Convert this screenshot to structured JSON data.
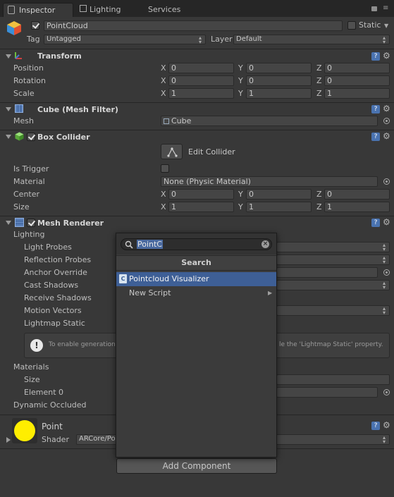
{
  "tabs": [
    {
      "label": "Inspector"
    },
    {
      "label": "Lighting"
    },
    {
      "label": "Services"
    }
  ],
  "object": {
    "name": "PointCloud",
    "active": true,
    "static_label": "Static",
    "tag_label": "Tag",
    "tag_value": "Untagged",
    "layer_label": "Layer",
    "layer_value": "Default"
  },
  "transform": {
    "title": "Transform",
    "position": {
      "label": "Position",
      "x": "0",
      "y": "0",
      "z": "0"
    },
    "rotation": {
      "label": "Rotation",
      "x": "0",
      "y": "0",
      "z": "0"
    },
    "scale": {
      "label": "Scale",
      "x": "1",
      "y": "1",
      "z": "1"
    }
  },
  "axes": {
    "x": "X",
    "y": "Y",
    "z": "Z"
  },
  "mesh_filter": {
    "title": "Cube (Mesh Filter)",
    "mesh_label": "Mesh",
    "mesh_value": "Cube"
  },
  "box_collider": {
    "title": "Box Collider",
    "enabled": true,
    "edit_collider": "Edit Collider",
    "is_trigger_label": "Is Trigger",
    "material_label": "Material",
    "material_value": "None (Physic Material)",
    "center": {
      "label": "Center",
      "x": "0",
      "y": "0",
      "z": "0"
    },
    "size": {
      "label": "Size",
      "x": "1",
      "y": "1",
      "z": "1"
    }
  },
  "mesh_renderer": {
    "title": "Mesh Renderer",
    "enabled": true,
    "lighting_label": "Lighting",
    "light_probes": "Light Probes",
    "reflection_probes": "Reflection Probes",
    "anchor_override": "Anchor Override",
    "cast_shadows": "Cast Shadows",
    "receive_shadows": "Receive Shadows",
    "motion_vectors": "Motion Vectors",
    "lightmap_static": "Lightmap Static",
    "info_left": "To enable generation",
    "info_right": "le the 'Lightmap Static' property.",
    "materials_label": "Materials",
    "size_label": "Size",
    "element0_label": "Element 0",
    "dynamic_occluded": "Dynamic Occluded"
  },
  "material": {
    "name": "Point",
    "shader_label": "Shader",
    "shader_value": "ARCore/Po",
    "swatch_color": "#ffee00"
  },
  "popup": {
    "search_text": "PointC",
    "header": "Search",
    "items": [
      {
        "label": "Pointcloud Visualizer",
        "selected": true
      },
      {
        "label": "New Script",
        "selected": false
      }
    ]
  },
  "add_component": "Add Component",
  "colors": {
    "background": "#383838",
    "selection": "#3e5f96",
    "help_icon": "#4a73b0"
  }
}
